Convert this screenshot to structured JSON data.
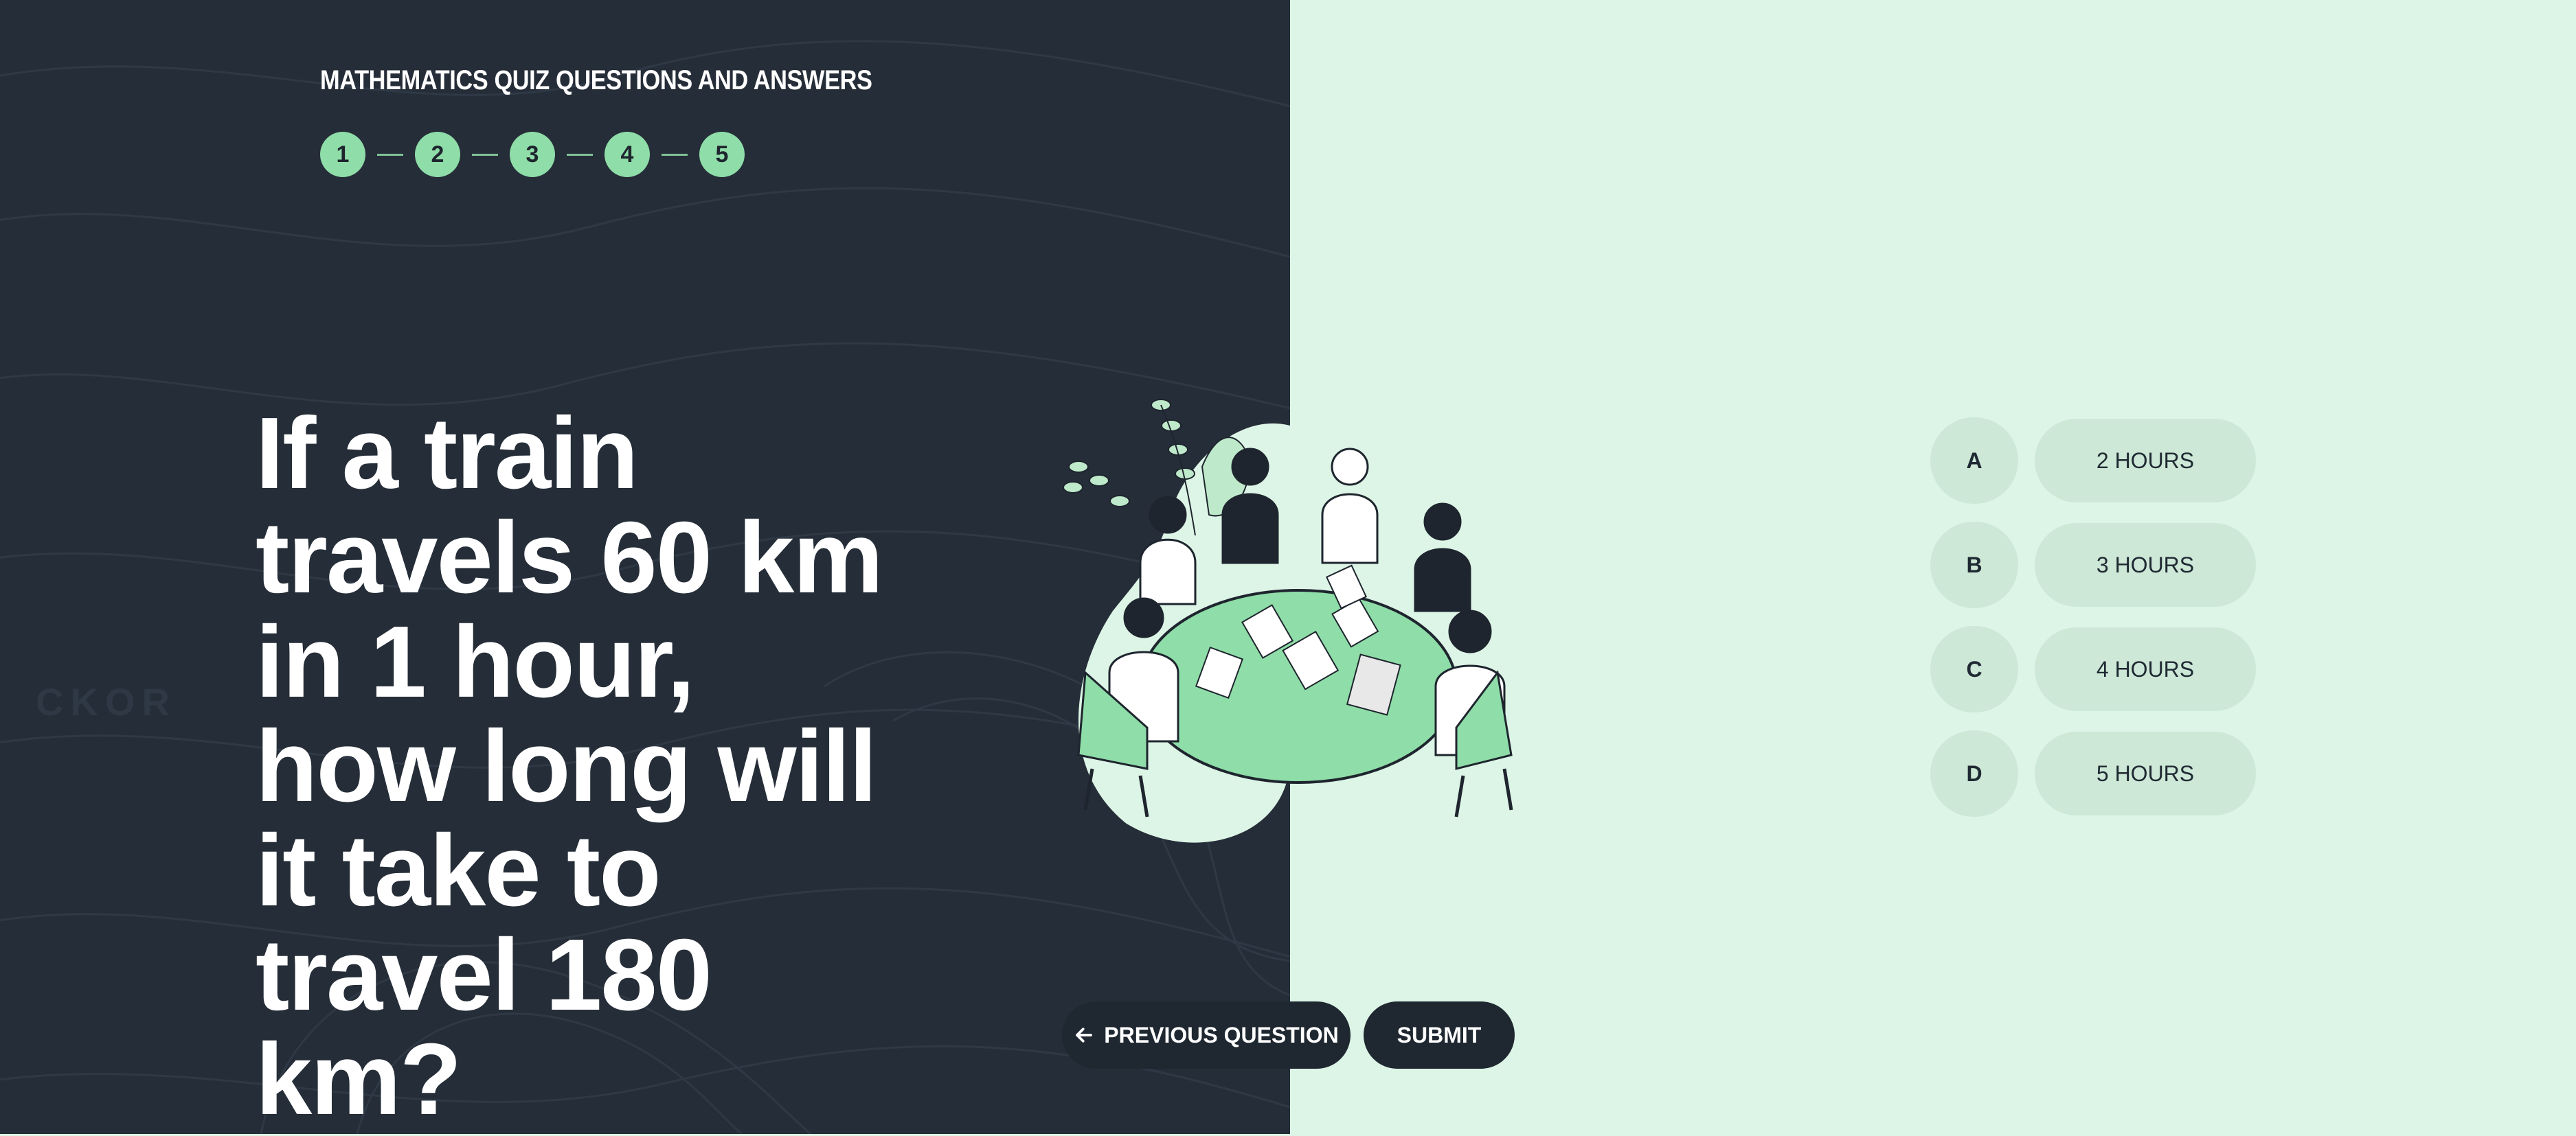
{
  "quiz": {
    "title": "MATHEMATICS QUIZ QUESTIONS AND ANSWERS",
    "steps": [
      "1",
      "2",
      "3",
      "4",
      "5"
    ],
    "question": "If a train travels 60 km in 1 hour, how long will it take to travel 180 km?"
  },
  "options": [
    {
      "letter": "A",
      "label": "2 HOURS"
    },
    {
      "letter": "B",
      "label": "3 HOURS"
    },
    {
      "letter": "C",
      "label": "4 HOURS"
    },
    {
      "letter": "D",
      "label": "5 HOURS"
    }
  ],
  "buttons": {
    "previous_label": "PREVIOUS QUESTION",
    "previous_icon": "arrow-left-icon",
    "submit_label": "SUBMIT"
  },
  "colors": {
    "dark_panel": "#252d38",
    "light_panel": "#ddf5e6",
    "accent_green": "#8fdda8",
    "option_bg": "#cde8d6",
    "button_bg": "#1f2830"
  }
}
